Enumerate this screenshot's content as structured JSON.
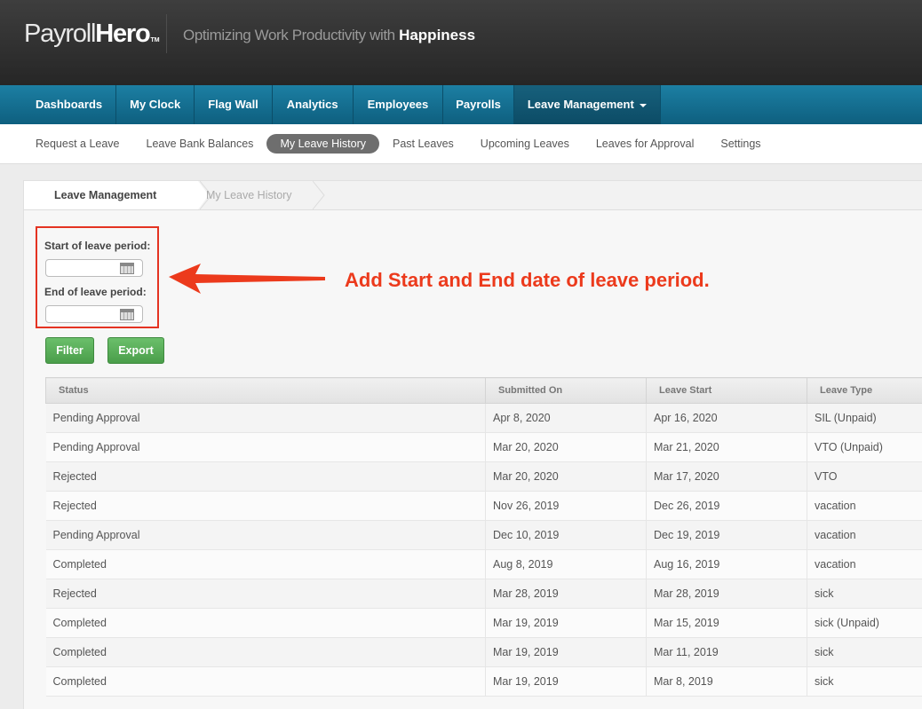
{
  "header": {
    "logo_thin": "Payroll",
    "logo_bold": "Hero",
    "logo_tm": "TM",
    "tagline": "Optimizing Work Productivity with",
    "tagline_strong": "Happiness"
  },
  "mainnav": {
    "items": [
      {
        "label": "Dashboards"
      },
      {
        "label": "My Clock"
      },
      {
        "label": "Flag Wall"
      },
      {
        "label": "Analytics"
      },
      {
        "label": "Employees"
      },
      {
        "label": "Payrolls"
      },
      {
        "label": "Leave Management",
        "active": true
      }
    ]
  },
  "subnav": {
    "items": [
      {
        "label": "Request a Leave"
      },
      {
        "label": "Leave Bank Balances"
      },
      {
        "label": "My Leave History",
        "active": true
      },
      {
        "label": "Past Leaves"
      },
      {
        "label": "Upcoming Leaves"
      },
      {
        "label": "Leaves for Approval"
      },
      {
        "label": "Settings"
      }
    ]
  },
  "breadcrumb": {
    "first": "Leave Management",
    "second": "My Leave History"
  },
  "filter": {
    "start_label": "Start of leave period:",
    "start_value": "",
    "end_label": "End of leave period:",
    "end_value": "",
    "filter_button": "Filter",
    "export_button": "Export"
  },
  "annotation": {
    "text": "Add Start and End date of leave period.",
    "color": "#ec3a1c"
  },
  "table": {
    "headers": [
      "Status",
      "Submitted On",
      "Leave Start",
      "Leave Type"
    ],
    "rows": [
      [
        "Pending Approval",
        "Apr 8, 2020",
        "Apr 16, 2020",
        "SIL (Unpaid)"
      ],
      [
        "Pending Approval",
        "Mar 20, 2020",
        "Mar 21, 2020",
        "VTO (Unpaid)"
      ],
      [
        "Rejected",
        "Mar 20, 2020",
        "Mar 17, 2020",
        "VTO"
      ],
      [
        "Rejected",
        "Nov 26, 2019",
        "Dec 26, 2019",
        "vacation"
      ],
      [
        "Pending Approval",
        "Dec 10, 2019",
        "Dec 19, 2019",
        "vacation"
      ],
      [
        "Completed",
        "Aug 8, 2019",
        "Aug 16, 2019",
        "vacation"
      ],
      [
        "Rejected",
        "Mar 28, 2019",
        "Mar 28, 2019",
        "sick"
      ],
      [
        "Completed",
        "Mar 19, 2019",
        "Mar 15, 2019",
        "sick (Unpaid)"
      ],
      [
        "Completed",
        "Mar 19, 2019",
        "Mar 11, 2019",
        "sick"
      ],
      [
        "Completed",
        "Mar 19, 2019",
        "Mar 8, 2019",
        "sick"
      ]
    ]
  }
}
